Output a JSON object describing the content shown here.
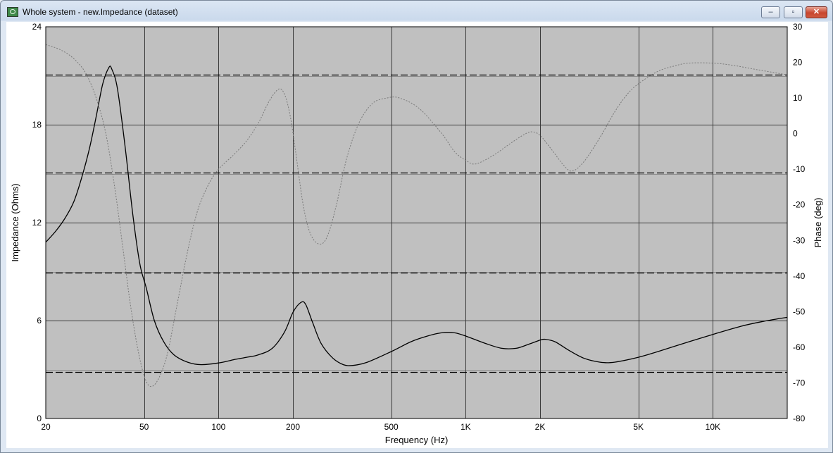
{
  "window": {
    "title": "Whole system - new.Impedance (dataset)",
    "minimize_label": "‒",
    "maximize_label": "▫",
    "close_label": "✕"
  },
  "chart_data": {
    "type": "line",
    "xlabel": "Frequency (Hz)",
    "ylabel": "Impedance (Ohms)",
    "y2label": "Phase (deg)",
    "xscale": "log",
    "xlim": [
      20,
      20000
    ],
    "ylim": [
      0,
      24
    ],
    "y2lim": [
      -80,
      30
    ],
    "x_ticks": [
      20,
      50,
      100,
      200,
      500,
      1000,
      2000,
      5000,
      10000
    ],
    "x_tick_labels": [
      "20",
      "50",
      "100",
      "200",
      "500",
      "1K",
      "2K",
      "5K",
      "10K"
    ],
    "y_ticks": [
      0,
      6,
      12,
      18,
      24
    ],
    "y2_ticks": [
      -80,
      -70,
      -60,
      -50,
      -40,
      -30,
      -20,
      -10,
      0,
      10,
      20,
      30
    ],
    "dashed_y2_lines": [
      -67,
      -39,
      -11,
      16.5
    ],
    "grid": true,
    "plot_background": "#c0c0c0",
    "series": [
      {
        "axis": "left",
        "style": "solid",
        "color": "#000000",
        "points": [
          [
            20,
            10.8
          ],
          [
            22,
            11.5
          ],
          [
            24,
            12.3
          ],
          [
            26,
            13.3
          ],
          [
            28,
            14.8
          ],
          [
            30,
            16.5
          ],
          [
            32,
            18.5
          ],
          [
            34,
            20.5
          ],
          [
            36,
            21.5
          ],
          [
            37,
            21.4
          ],
          [
            39,
            20.2
          ],
          [
            42,
            16.5
          ],
          [
            45,
            12.5
          ],
          [
            48,
            9.5
          ],
          [
            51,
            8.0
          ],
          [
            55,
            6.0
          ],
          [
            60,
            4.7
          ],
          [
            66,
            3.9
          ],
          [
            75,
            3.45
          ],
          [
            85,
            3.3
          ],
          [
            100,
            3.4
          ],
          [
            115,
            3.6
          ],
          [
            130,
            3.75
          ],
          [
            145,
            3.9
          ],
          [
            165,
            4.3
          ],
          [
            185,
            5.3
          ],
          [
            200,
            6.5
          ],
          [
            215,
            7.1
          ],
          [
            225,
            7.0
          ],
          [
            240,
            5.9
          ],
          [
            260,
            4.6
          ],
          [
            290,
            3.7
          ],
          [
            320,
            3.3
          ],
          [
            350,
            3.25
          ],
          [
            400,
            3.45
          ],
          [
            500,
            4.1
          ],
          [
            600,
            4.7
          ],
          [
            700,
            5.05
          ],
          [
            800,
            5.25
          ],
          [
            900,
            5.25
          ],
          [
            1000,
            5.05
          ],
          [
            1200,
            4.6
          ],
          [
            1400,
            4.3
          ],
          [
            1600,
            4.3
          ],
          [
            1800,
            4.55
          ],
          [
            2000,
            4.8
          ],
          [
            2100,
            4.85
          ],
          [
            2300,
            4.7
          ],
          [
            2600,
            4.2
          ],
          [
            3000,
            3.7
          ],
          [
            3500,
            3.45
          ],
          [
            4000,
            3.45
          ],
          [
            5000,
            3.75
          ],
          [
            6000,
            4.1
          ],
          [
            8000,
            4.7
          ],
          [
            10000,
            5.15
          ],
          [
            13000,
            5.65
          ],
          [
            16000,
            5.95
          ],
          [
            20000,
            6.2
          ]
        ]
      },
      {
        "axis": "right",
        "style": "dotted",
        "color": "#7a7a7a",
        "points": [
          [
            20,
            25
          ],
          [
            23,
            23.5
          ],
          [
            26,
            21
          ],
          [
            29,
            17
          ],
          [
            32,
            10
          ],
          [
            35,
            0
          ],
          [
            38,
            -15
          ],
          [
            41,
            -32
          ],
          [
            44,
            -48
          ],
          [
            47,
            -60
          ],
          [
            50,
            -68
          ],
          [
            53,
            -71
          ],
          [
            57,
            -69
          ],
          [
            62,
            -62
          ],
          [
            68,
            -48
          ],
          [
            75,
            -33
          ],
          [
            82,
            -22
          ],
          [
            90,
            -15
          ],
          [
            100,
            -10
          ],
          [
            115,
            -6
          ],
          [
            130,
            -2
          ],
          [
            145,
            3
          ],
          [
            160,
            9
          ],
          [
            175,
            12.5
          ],
          [
            185,
            11
          ],
          [
            195,
            5
          ],
          [
            205,
            -5
          ],
          [
            220,
            -20
          ],
          [
            235,
            -28
          ],
          [
            255,
            -31
          ],
          [
            275,
            -29
          ],
          [
            300,
            -20
          ],
          [
            330,
            -7
          ],
          [
            370,
            3
          ],
          [
            420,
            8.5
          ],
          [
            480,
            10
          ],
          [
            540,
            10
          ],
          [
            650,
            7
          ],
          [
            800,
            0
          ],
          [
            900,
            -5
          ],
          [
            1000,
            -7.5
          ],
          [
            1100,
            -8.5
          ],
          [
            1300,
            -6
          ],
          [
            1500,
            -3
          ],
          [
            1700,
            -0.5
          ],
          [
            1850,
            0.5
          ],
          [
            2000,
            -0.5
          ],
          [
            2200,
            -4
          ],
          [
            2500,
            -9
          ],
          [
            2700,
            -10.5
          ],
          [
            3000,
            -8
          ],
          [
            3500,
            -1
          ],
          [
            4000,
            6
          ],
          [
            4500,
            11
          ],
          [
            5000,
            14
          ],
          [
            6000,
            17.5
          ],
          [
            7000,
            19
          ],
          [
            8000,
            19.8
          ],
          [
            10000,
            19.8
          ],
          [
            12000,
            19.2
          ],
          [
            15000,
            18
          ],
          [
            20000,
            16.5
          ]
        ]
      }
    ]
  }
}
